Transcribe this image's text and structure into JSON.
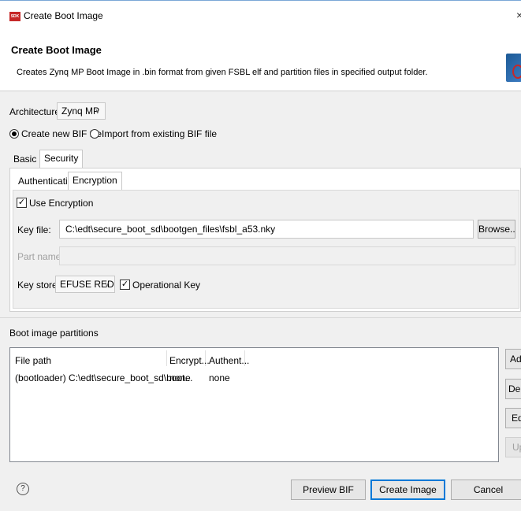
{
  "window": {
    "icon_text": "SDK",
    "title": "Create Boot Image",
    "close": "×"
  },
  "header": {
    "title": "Create Boot Image",
    "description": "Creates Zynq MP Boot Image in .bin format from given FSBL elf and partition files in specified output folder."
  },
  "architecture": {
    "label": "Architecture:",
    "value": "Zynq MP"
  },
  "bif_mode": {
    "options": [
      {
        "label": "Create new BIF file",
        "selected": true
      },
      {
        "label": "Import from existing BIF file",
        "selected": false
      }
    ]
  },
  "main_tabs": [
    {
      "label": "Basic",
      "active": false
    },
    {
      "label": "Security",
      "active": true
    }
  ],
  "security_tabs": [
    {
      "label": "Authentication",
      "active": false
    },
    {
      "label": "Encryption",
      "active": true
    }
  ],
  "encryption": {
    "use_encryption": {
      "label": "Use Encryption",
      "checked": true
    },
    "key_file": {
      "label": "Key file:",
      "value": "C:\\edt\\secure_boot_sd\\bootgen_files\\fsbl_a53.nky",
      "browse": "Browse..."
    },
    "part_name": {
      "label": "Part name:",
      "value": ""
    },
    "key_store": {
      "label": "Key store:",
      "value": "EFUSE RED"
    },
    "operational_key": {
      "label": "Operational Key",
      "checked": true
    }
  },
  "partitions": {
    "title": "Boot image partitions",
    "columns": [
      "File path",
      "Encrypt...",
      "Authent..."
    ],
    "rows": [
      {
        "file": "(bootloader) C:\\edt\\secure_boot_sd\\boot...",
        "encrypt": "none",
        "auth": "none"
      }
    ],
    "buttons": {
      "add": "Add",
      "delete": "Delete",
      "edit": "Edit",
      "up": "Up"
    }
  },
  "footer": {
    "help": "?",
    "preview": "Preview BIF Changes",
    "create": "Create Image",
    "cancel": "Cancel"
  },
  "colors": {
    "accent": "#0078d7",
    "title_border": "#7aa7d6"
  }
}
